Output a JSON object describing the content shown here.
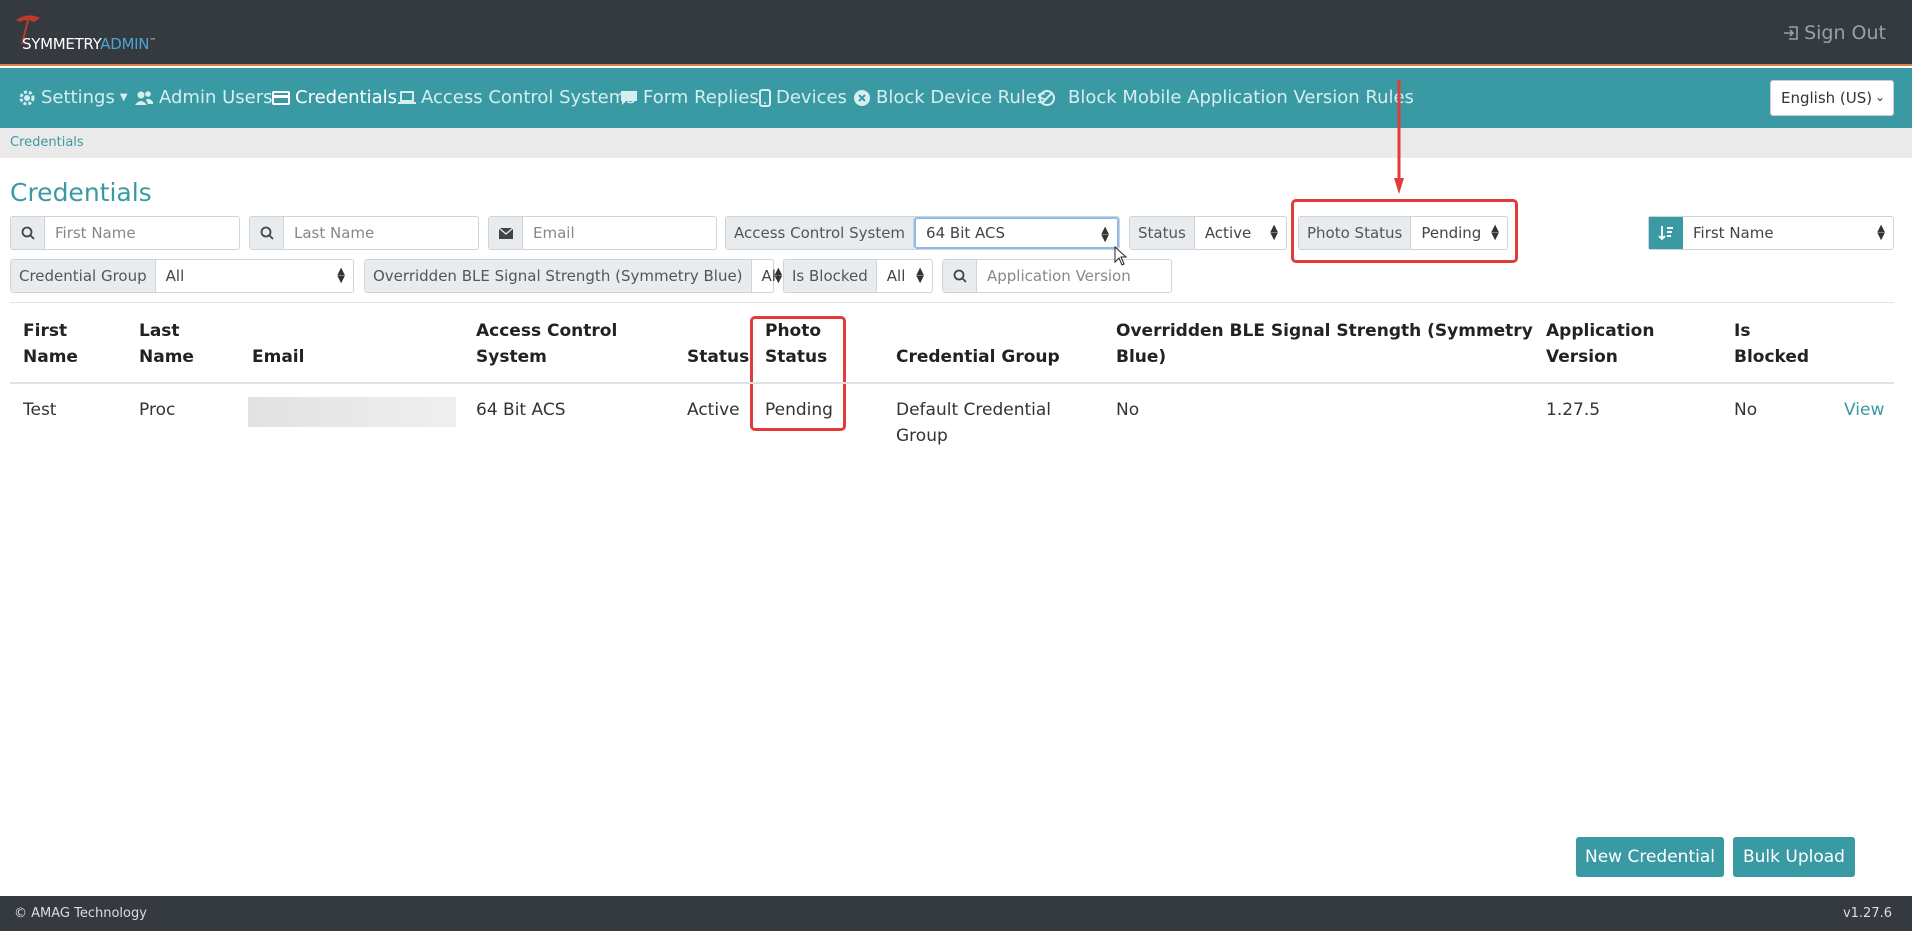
{
  "header": {
    "brand_main": "SYMMETRY",
    "brand_accent": "ADMIN",
    "brand_mark": "™",
    "sign_out_label": "Sign Out"
  },
  "nav": {
    "items": [
      {
        "label": "Settings",
        "icon": "gear-icon"
      },
      {
        "label": "Admin Users",
        "icon": "users-icon"
      },
      {
        "label": "Credentials",
        "icon": "id-card-icon"
      },
      {
        "label": "Access Control Systems",
        "icon": "laptop-icon"
      },
      {
        "label": "Form Replies",
        "icon": "comment-icon"
      },
      {
        "label": "Devices",
        "icon": "mobile-icon"
      },
      {
        "label": "Block Device Rules",
        "icon": "times-circle-icon"
      },
      {
        "label": "Block Mobile Application Version Rules",
        "icon": "ban-icon"
      }
    ],
    "language": "English (US)"
  },
  "breadcrumb": "Credentials",
  "page_title": "Credentials",
  "filters": {
    "first_name_placeholder": "First Name",
    "last_name_placeholder": "Last Name",
    "email_placeholder": "Email",
    "acs_label": "Access Control System",
    "acs_value": "64 Bit ACS",
    "status_label": "Status",
    "status_value": "Active",
    "photo_status_label": "Photo Status",
    "photo_status_value": "Pending",
    "sort_value": "First Name",
    "credential_group_label": "Credential Group",
    "credential_group_value": "All",
    "ble_label": "Overridden BLE Signal Strength (Symmetry Blue)",
    "ble_value": "All",
    "is_blocked_label": "Is Blocked",
    "is_blocked_value": "All",
    "app_version_placeholder": "Application Version"
  },
  "table": {
    "headers": {
      "first_name_1": "First",
      "first_name_2": "Name",
      "last_name_1": "Last",
      "last_name_2": "Name",
      "email": "Email",
      "acs_1": "Access Control",
      "acs_2": "System",
      "status": "Status",
      "photo_1": "Photo",
      "photo_2": "Status",
      "group": "Credential Group",
      "ble_1": "Overridden BLE Signal Strength (Symmetry",
      "ble_2": "Blue)",
      "app_1": "Application",
      "app_2": "Version",
      "blocked_1": "Is",
      "blocked_2": "Blocked"
    },
    "rows": [
      {
        "first_name": "Test",
        "last_name": "Proc",
        "acs": "64 Bit ACS",
        "status": "Active",
        "photo_status": "Pending",
        "group_1": "Default Credential",
        "group_2": "Group",
        "ble": "No",
        "app_version": "1.27.5",
        "is_blocked": "No",
        "action": "View"
      }
    ]
  },
  "actions": {
    "new_credential": "New Credential",
    "bulk_upload": "Bulk Upload"
  },
  "footer": {
    "copyright": "© AMAG Technology",
    "version": "v1.27.6"
  },
  "colors": {
    "nav_bg": "#3a9aa3",
    "header_bg": "#343a40",
    "highlight": "#e23b3b"
  }
}
